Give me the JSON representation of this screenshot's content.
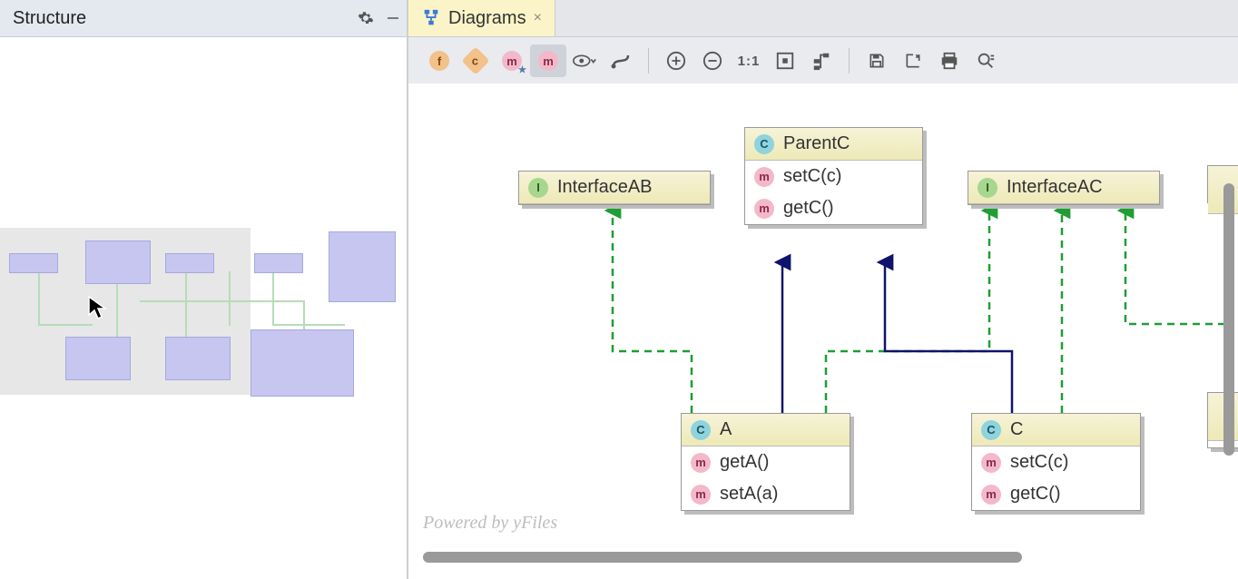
{
  "structure_panel": {
    "title": "Structure"
  },
  "tab": {
    "label": "Diagrams"
  },
  "watermark": "Powered by yFiles",
  "nodes": {
    "interfaceAB": {
      "title": "InterfaceAB"
    },
    "interfaceAC": {
      "title": "InterfaceAC"
    },
    "parentC": {
      "title": "ParentC",
      "m1": "setC(c)",
      "m2": "getC()"
    },
    "classA": {
      "title": "A",
      "m1": "getA()",
      "m2": "setA(a)"
    },
    "classC": {
      "title": "C",
      "m1": "setC(c)",
      "m2": "getC()"
    }
  },
  "toolbar_badges": {
    "f": "f",
    "c": "c",
    "m1": "m",
    "m2": "m",
    "ratio": "1:1"
  }
}
